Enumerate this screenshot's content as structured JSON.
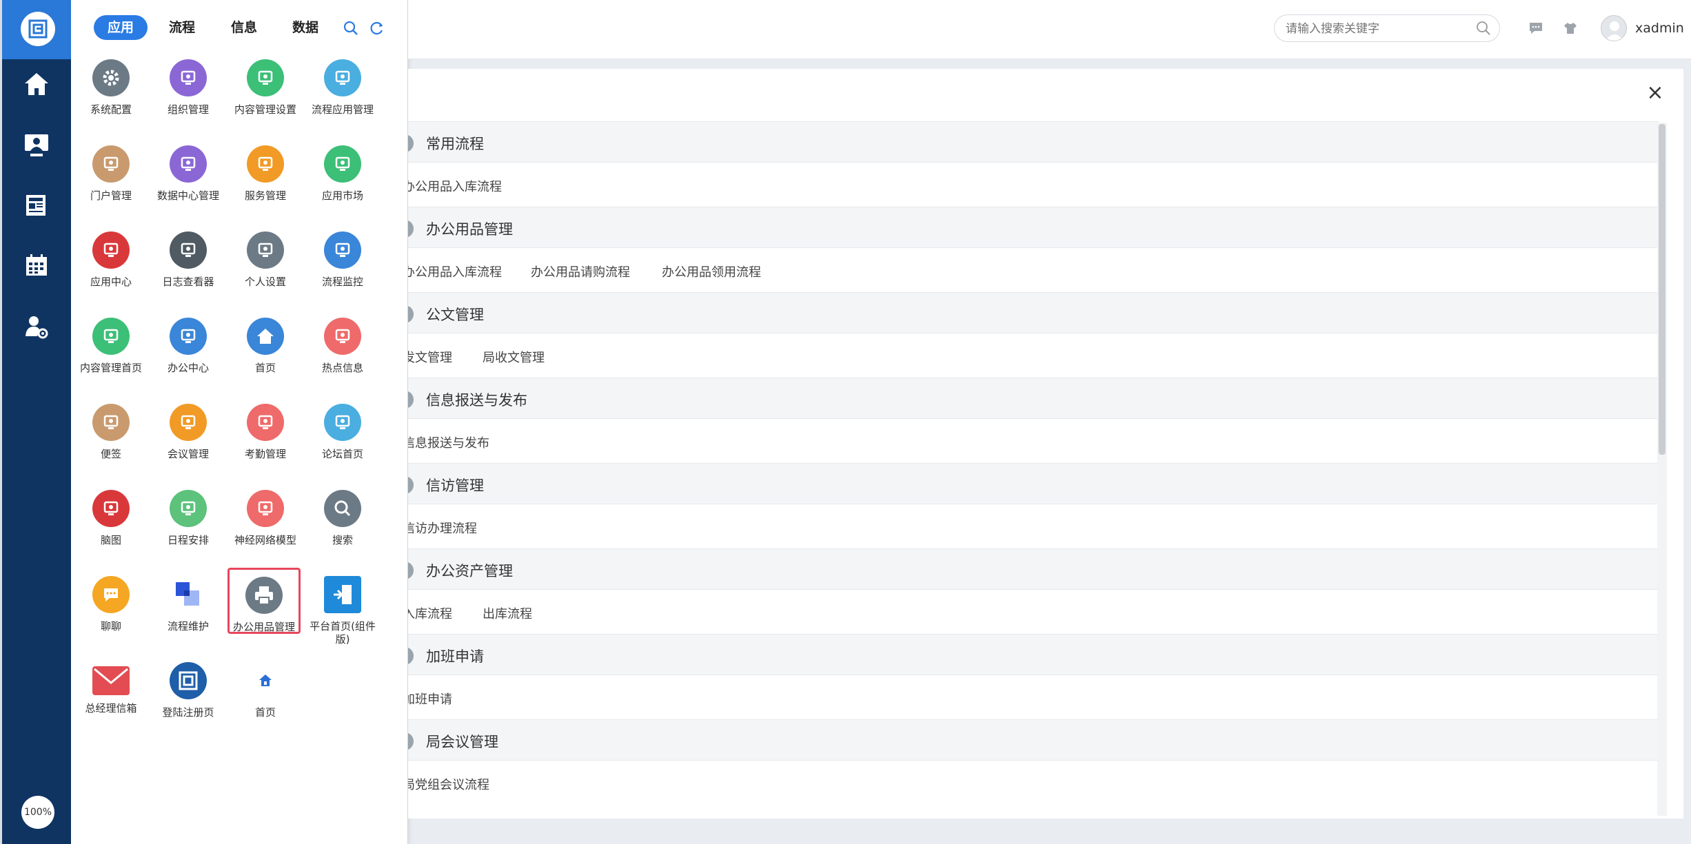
{
  "rail": {
    "items": [
      {
        "name": "home-icon"
      },
      {
        "name": "monitor-user-icon"
      },
      {
        "name": "news-icon"
      },
      {
        "name": "calendar-icon"
      },
      {
        "name": "user-settings-icon"
      }
    ],
    "zoom": "100%"
  },
  "tabs": {
    "app": "应用",
    "flow": "流程",
    "info": "信息",
    "data": "数据"
  },
  "apps": [
    {
      "label": "系统配置",
      "color": "#6c7a86",
      "icon": "gear-icon"
    },
    {
      "label": "组织管理",
      "color": "#8b67d6",
      "icon": "org-icon"
    },
    {
      "label": "内容管理设置",
      "color": "#3cbf77",
      "icon": "monitor-icon"
    },
    {
      "label": "流程应用管理",
      "color": "#4aaee0",
      "icon": "flow-screen-icon"
    },
    {
      "label": "门户管理",
      "color": "#c99a6e",
      "icon": "portal-icon"
    },
    {
      "label": "数据中心管理",
      "color": "#8b67d6",
      "icon": "chart-icon"
    },
    {
      "label": "服务管理",
      "color": "#f19a26",
      "icon": "service-icon"
    },
    {
      "label": "应用市场",
      "color": "#3cbf77",
      "icon": "bag-icon"
    },
    {
      "label": "应用中心",
      "color": "#d9383b",
      "icon": "app-center-icon"
    },
    {
      "label": "日志查看器",
      "color": "#4f5a62",
      "icon": "log-icon"
    },
    {
      "label": "个人设置",
      "color": "#6c7a86",
      "icon": "person-gear-icon"
    },
    {
      "label": "流程监控",
      "color": "#3a86d8",
      "icon": "gauge-icon"
    },
    {
      "label": "内容管理首页",
      "color": "#3cbf77",
      "icon": "content-home-icon"
    },
    {
      "label": "办公中心",
      "color": "#3a86d8",
      "icon": "office-icon"
    },
    {
      "label": "首页",
      "color": "#3a86d8",
      "icon": "home-icon"
    },
    {
      "label": "热点信息",
      "color": "#ef6a6a",
      "icon": "fire-icon"
    },
    {
      "label": "便签",
      "color": "#c99a6e",
      "icon": "note-icon"
    },
    {
      "label": "会议管理",
      "color": "#f19a26",
      "icon": "meeting-icon"
    },
    {
      "label": "考勤管理",
      "color": "#ef6a6a",
      "icon": "finger-icon"
    },
    {
      "label": "论坛首页",
      "color": "#4aaee0",
      "icon": "forum-icon"
    },
    {
      "label": "脑图",
      "color": "#d9383b",
      "icon": "mindmap-icon"
    },
    {
      "label": "日程安排",
      "color": "#5cc27c",
      "icon": "schedule-icon"
    },
    {
      "label": "神经网络模型",
      "color": "#ef6a6a",
      "icon": "brain-icon"
    },
    {
      "label": "搜索",
      "color": "#6c7a86",
      "icon": "search-icon"
    },
    {
      "label": "聊聊",
      "color": "#f5a623",
      "icon": "chat-icon"
    },
    {
      "label": "流程维护",
      "color": "#ffffff",
      "icon": "flow-maintain-icon"
    },
    {
      "label": "办公用品管理",
      "color": "#6c7a86",
      "icon": "printer-icon"
    },
    {
      "label": "平台首页(组件版)",
      "color": "#1f8ad9",
      "icon": "door-enter-icon"
    },
    {
      "label": "总经理信箱",
      "color": "#e24c52",
      "icon": "mail-icon"
    },
    {
      "label": "登陆注册页",
      "color": "#1f5ea8",
      "icon": "login-icon"
    },
    {
      "label": "首页",
      "color": "#ffffff",
      "icon": "small-home-icon"
    }
  ],
  "header": {
    "search_placeholder": "请输入搜索关键字",
    "username": "xadmin"
  },
  "sections": [
    {
      "title": "常用流程",
      "links": [
        "办公用品入库流程"
      ]
    },
    {
      "title": "办公用品管理",
      "links": [
        "办公用品入库流程",
        "办公用品请购流程",
        "办公用品领用流程"
      ]
    },
    {
      "title": "公文管理",
      "links": [
        "发文管理",
        "局收文管理"
      ]
    },
    {
      "title": "信息报送与发布",
      "links": [
        "信息报送与发布"
      ]
    },
    {
      "title": "信访管理",
      "links": [
        "信访办理流程"
      ]
    },
    {
      "title": "办公资产管理",
      "links": [
        "入库流程",
        "出库流程"
      ]
    },
    {
      "title": "加班申请",
      "links": [
        "加班申请"
      ]
    },
    {
      "title": "局会议管理",
      "links": [
        "局党组会议流程"
      ]
    }
  ],
  "close_label": "×"
}
